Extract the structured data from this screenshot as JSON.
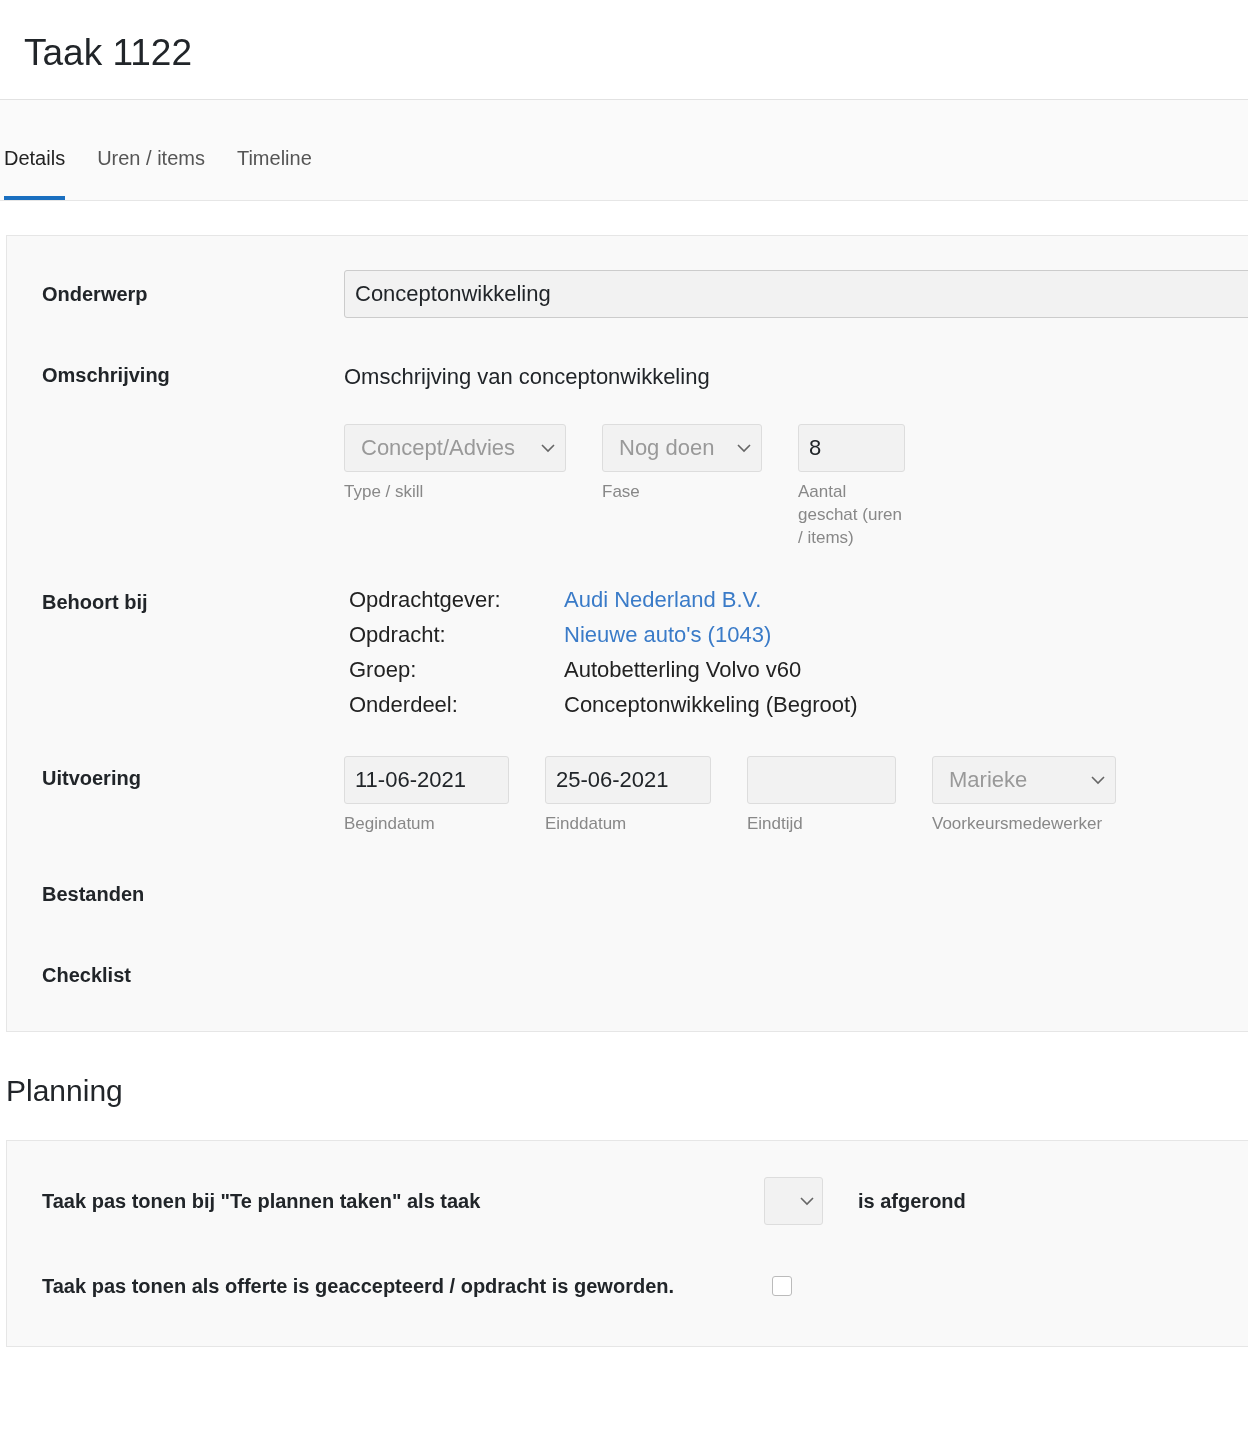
{
  "page": {
    "title": "Taak 1122"
  },
  "tabs": [
    {
      "label": "Details",
      "selected": true
    },
    {
      "label": "Uren / items",
      "selected": false
    },
    {
      "label": "Timeline",
      "selected": false
    }
  ],
  "details": {
    "subject": {
      "label": "Onderwerp",
      "value": "Conceptonwikkeling"
    },
    "description": {
      "label": "Omschrijving",
      "text": "Omschrijving van conceptonwikkeling"
    },
    "fields": [
      {
        "kind": "select",
        "value": "Concept/Advies",
        "caption": "Type / skill",
        "disabled": true
      },
      {
        "kind": "select",
        "value": "Nog doen",
        "caption": "Fase",
        "disabled": true
      },
      {
        "kind": "input",
        "value": "8",
        "caption": "Aantal geschat (uren / items)"
      }
    ],
    "belongs": {
      "label": "Behoort bij",
      "rows": [
        {
          "key": "Opdrachtgever:",
          "value": "Audi Nederland B.V.",
          "kind": "link"
        },
        {
          "key": "Opdracht:",
          "value": "Nieuwe auto's (1043)",
          "kind": "link"
        },
        {
          "key": "Groep:",
          "value": "Autobetterling Volvo v60",
          "kind": "text"
        },
        {
          "key": "Onderdeel:",
          "value": "Conceptonwikkeling (Begroot)",
          "kind": "text"
        }
      ]
    },
    "execution": {
      "label": "Uitvoering",
      "fields": [
        {
          "kind": "input",
          "value": "11-06-2021",
          "caption": "Begindatum"
        },
        {
          "kind": "input",
          "value": "25-06-2021",
          "caption": "Einddatum"
        },
        {
          "kind": "input",
          "caption": "Eindtijd"
        },
        {
          "kind": "select",
          "value": "Marieke",
          "caption": "Voorkeursmedewerker",
          "disabled": true
        }
      ]
    },
    "files": {
      "label": "Bestanden"
    },
    "checklist": {
      "label": "Checklist"
    }
  },
  "planning": {
    "title": "Planning",
    "rows": [
      {
        "kind": "select",
        "text": "Taak pas tonen bij \"Te plannen taken\" als taak",
        "suffix": "is afgerond"
      },
      {
        "kind": "checkbox",
        "text": "Taak pas tonen als offerte is geaccepteerd / opdracht is geworden.",
        "checked": false
      }
    ]
  }
}
